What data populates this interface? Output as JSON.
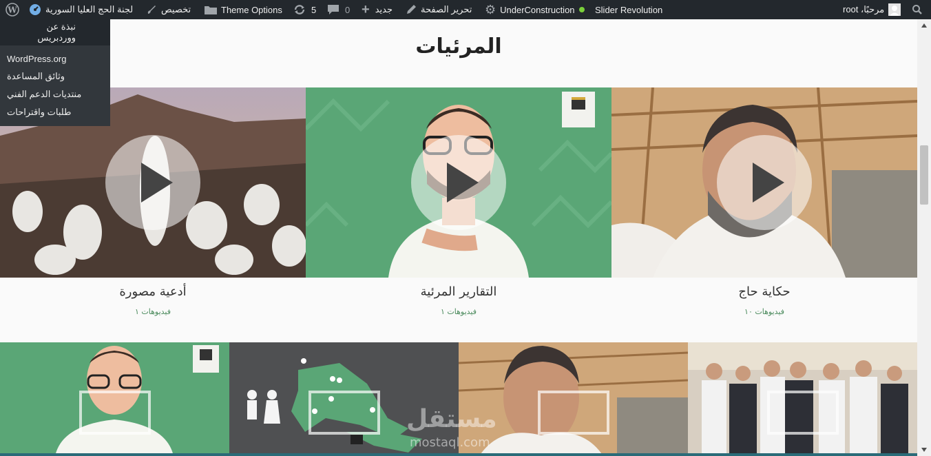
{
  "adminbar": {
    "user_greeting": "مرحبًا، root",
    "slider_revolution": "Slider Revolution",
    "under_construction": "UnderConstruction",
    "edit_page": "تحرير الصفحة",
    "new": "جديد",
    "comments_count": "0",
    "updates_count": "5",
    "theme_options": "Theme Options",
    "customize": "تخصيص",
    "site_name": "لجنة الحج العليا السورية",
    "status_color": "#72aee6"
  },
  "wp_menu": {
    "about": "نبذة عن ووردبريس",
    "items": [
      "WordPress.org",
      "وثائق المساعدة",
      "منتديات الدعم الفني",
      "طلبات واقتراحات"
    ]
  },
  "section": {
    "title": "المرئيات"
  },
  "cards": [
    {
      "title": "أدعية مصورة",
      "count": "فيديوهات ١"
    },
    {
      "title": "التقارير المرئية",
      "count": "فيديوهات ١"
    },
    {
      "title": "حكاية حاج",
      "count": "فيديوهات ١٠"
    }
  ],
  "watermark": {
    "text": "مستقل",
    "sub": "mostaql.com"
  },
  "colors": {
    "adminbar": "#23282d",
    "green": "#5aa676",
    "dark_gray": "#4f5052",
    "accent_green": "#4a8a5c"
  }
}
